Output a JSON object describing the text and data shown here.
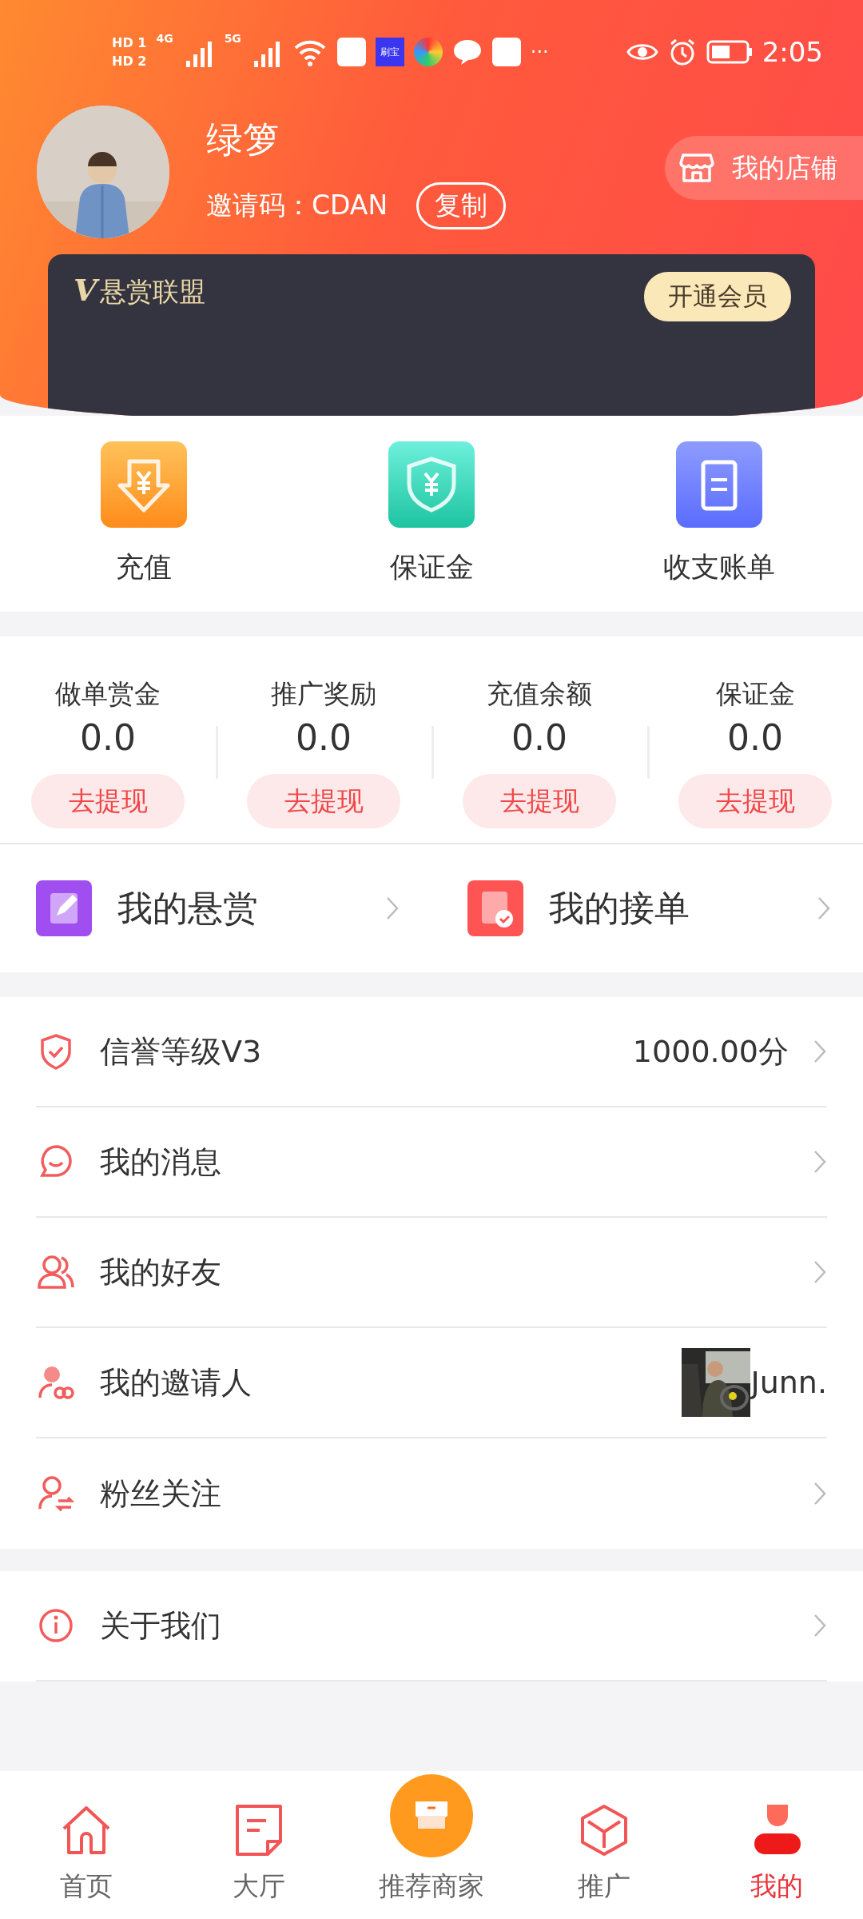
{
  "status_bar": {
    "sims": [
      {
        "label": "HD",
        "slot": "1"
      },
      {
        "label": "HD",
        "slot": "2"
      }
    ],
    "networks": [
      {
        "label": "4G"
      },
      {
        "label": "5G"
      }
    ],
    "app_badge": "刷宝",
    "more": "···",
    "time": "2:05"
  },
  "profile": {
    "name": "绿箩",
    "invite_label": "邀请码：",
    "invite_code": "CDAN",
    "copy_button": "复制",
    "shop_button": "我的店铺"
  },
  "vip_banner": {
    "mark": "V",
    "title": "悬赏联盟",
    "button": "开通会员"
  },
  "quick_actions": [
    {
      "label": "充值",
      "kind": "recharge"
    },
    {
      "label": "保证金",
      "kind": "deposit"
    },
    {
      "label": "收支账单",
      "kind": "bill"
    }
  ],
  "balances": [
    {
      "label": "做单赏金",
      "value": "0.0",
      "button": "去提现"
    },
    {
      "label": "推广奖励",
      "value": "0.0",
      "button": "去提现"
    },
    {
      "label": "充值余额",
      "value": "0.0",
      "button": "去提现"
    },
    {
      "label": "保证金",
      "value": "0.0",
      "button": "去提现"
    }
  ],
  "task_links": [
    {
      "label": "我的悬赏",
      "kind": "bounty"
    },
    {
      "label": "我的接单",
      "kind": "orders"
    }
  ],
  "menu": [
    {
      "label": "信誉等级V3",
      "kind": "credit",
      "value": "1000.00分"
    },
    {
      "label": "我的消息",
      "kind": "message"
    },
    {
      "label": "我的好友",
      "kind": "friends"
    },
    {
      "label": "我的邀请人",
      "kind": "inviter",
      "value": "Junn."
    },
    {
      "label": "粉丝关注",
      "kind": "fans"
    }
  ],
  "about_menu": [
    {
      "label": "关于我们",
      "kind": "about"
    }
  ],
  "tab_bar": [
    {
      "label": "首页",
      "kind": "home",
      "selected": false
    },
    {
      "label": "大厅",
      "kind": "hall",
      "selected": false
    },
    {
      "label": "推荐商家",
      "kind": "shops",
      "selected": false
    },
    {
      "label": "推广",
      "kind": "promote",
      "selected": false
    },
    {
      "label": "我的",
      "kind": "me",
      "selected": true
    }
  ]
}
